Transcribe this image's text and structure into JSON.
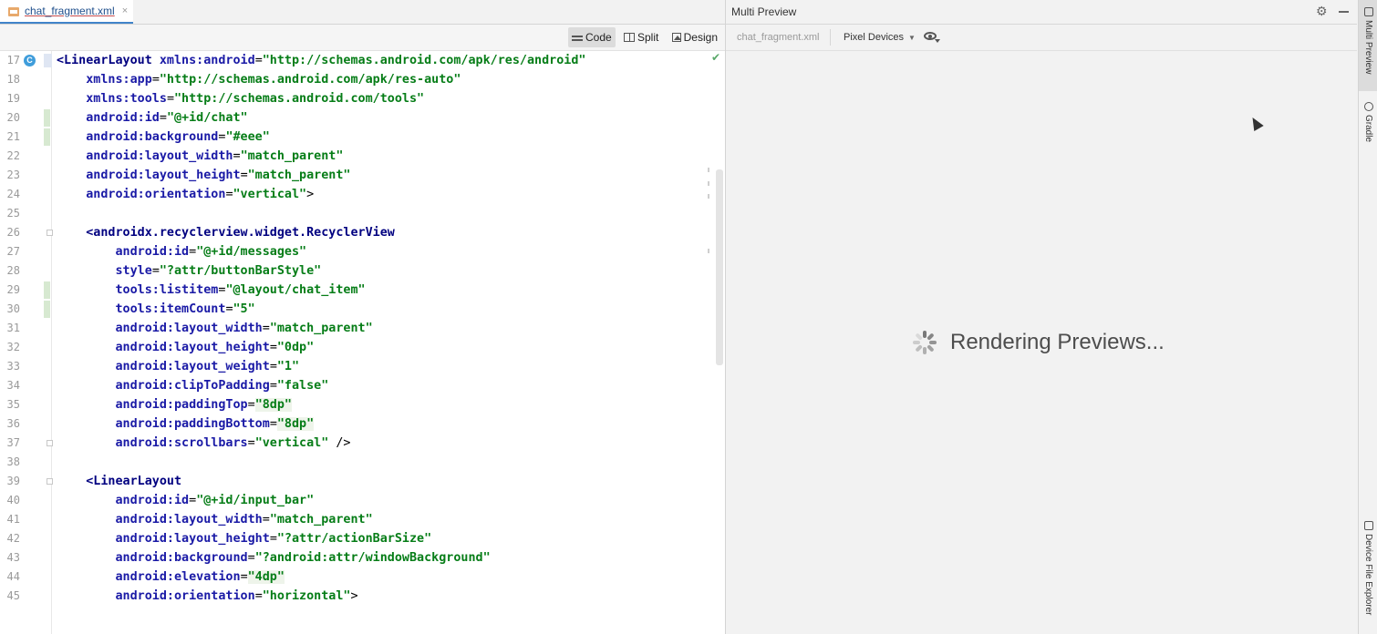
{
  "editor": {
    "tab": {
      "filename": "chat_fragment.xml",
      "close": "×"
    },
    "toolbar": {
      "code": "Code",
      "split": "Split",
      "design": "Design"
    },
    "gutter_badge": "C",
    "lines": [
      {
        "n": "17",
        "indent": "",
        "tokens": [
          [
            "tag",
            "<LinearLayout"
          ],
          [
            "punc",
            " "
          ],
          [
            "attr",
            "xmlns:android"
          ],
          [
            "punc",
            "="
          ],
          [
            "val",
            "\"http://schemas.android.com/apk/res/android\""
          ]
        ]
      },
      {
        "n": "18",
        "indent": "    ",
        "tokens": [
          [
            "attr",
            "xmlns:app"
          ],
          [
            "punc",
            "="
          ],
          [
            "val",
            "\"http://schemas.android.com/apk/res-auto\""
          ]
        ]
      },
      {
        "n": "19",
        "indent": "    ",
        "tokens": [
          [
            "attr",
            "xmlns:tools"
          ],
          [
            "punc",
            "="
          ],
          [
            "val",
            "\"http://schemas.android.com/tools\""
          ]
        ]
      },
      {
        "n": "20",
        "indent": "    ",
        "tokens": [
          [
            "attr",
            "android:id"
          ],
          [
            "punc",
            "="
          ],
          [
            "val",
            "\"@+id/chat\""
          ]
        ]
      },
      {
        "n": "21",
        "indent": "    ",
        "tokens": [
          [
            "attr",
            "android:background"
          ],
          [
            "punc",
            "="
          ],
          [
            "val",
            "\"#eee\""
          ]
        ]
      },
      {
        "n": "22",
        "indent": "    ",
        "tokens": [
          [
            "attr",
            "android:layout_width"
          ],
          [
            "punc",
            "="
          ],
          [
            "val",
            "\"match_parent\""
          ]
        ]
      },
      {
        "n": "23",
        "indent": "    ",
        "tokens": [
          [
            "attr",
            "android:layout_height"
          ],
          [
            "punc",
            "="
          ],
          [
            "val",
            "\"match_parent\""
          ]
        ]
      },
      {
        "n": "24",
        "indent": "    ",
        "tokens": [
          [
            "attr",
            "android:orientation"
          ],
          [
            "punc",
            "="
          ],
          [
            "val",
            "\"vertical\""
          ],
          [
            "punc",
            ">"
          ]
        ]
      },
      {
        "n": "25",
        "indent": "",
        "tokens": []
      },
      {
        "n": "26",
        "indent": "    ",
        "tokens": [
          [
            "tag",
            "<androidx.recyclerview.widget.RecyclerView"
          ]
        ]
      },
      {
        "n": "27",
        "indent": "        ",
        "tokens": [
          [
            "attr",
            "android:id"
          ],
          [
            "punc",
            "="
          ],
          [
            "val",
            "\"@+id/messages\""
          ]
        ]
      },
      {
        "n": "28",
        "indent": "        ",
        "tokens": [
          [
            "attr",
            "style"
          ],
          [
            "punc",
            "="
          ],
          [
            "val",
            "\"?attr/buttonBarStyle\""
          ]
        ]
      },
      {
        "n": "29",
        "indent": "        ",
        "tokens": [
          [
            "attr",
            "tools:listitem"
          ],
          [
            "punc",
            "="
          ],
          [
            "val",
            "\"@layout/chat_item\""
          ]
        ]
      },
      {
        "n": "30",
        "indent": "        ",
        "tokens": [
          [
            "attr",
            "tools:itemCount"
          ],
          [
            "punc",
            "="
          ],
          [
            "val",
            "\"5\""
          ]
        ]
      },
      {
        "n": "31",
        "indent": "        ",
        "tokens": [
          [
            "attr",
            "android:layout_width"
          ],
          [
            "punc",
            "="
          ],
          [
            "val",
            "\"match_parent\""
          ]
        ]
      },
      {
        "n": "32",
        "indent": "        ",
        "tokens": [
          [
            "attr",
            "android:layout_height"
          ],
          [
            "punc",
            "="
          ],
          [
            "val",
            "\"0dp\""
          ]
        ]
      },
      {
        "n": "33",
        "indent": "        ",
        "tokens": [
          [
            "attr",
            "android:layout_weight"
          ],
          [
            "punc",
            "="
          ],
          [
            "val",
            "\"1\""
          ]
        ]
      },
      {
        "n": "34",
        "indent": "        ",
        "tokens": [
          [
            "attr",
            "android:clipToPadding"
          ],
          [
            "punc",
            "="
          ],
          [
            "val",
            "\"false\""
          ]
        ]
      },
      {
        "n": "35",
        "indent": "        ",
        "tokens": [
          [
            "attr",
            "android:paddingTop"
          ],
          [
            "punc",
            "="
          ],
          [
            "num",
            "\"8dp\""
          ]
        ]
      },
      {
        "n": "36",
        "indent": "        ",
        "tokens": [
          [
            "attr",
            "android:paddingBottom"
          ],
          [
            "punc",
            "="
          ],
          [
            "num",
            "\"8dp\""
          ]
        ]
      },
      {
        "n": "37",
        "indent": "        ",
        "tokens": [
          [
            "attr",
            "android:scrollbars"
          ],
          [
            "punc",
            "="
          ],
          [
            "val",
            "\"vertical\""
          ],
          [
            "punc",
            " />"
          ]
        ]
      },
      {
        "n": "38",
        "indent": "",
        "tokens": []
      },
      {
        "n": "39",
        "indent": "    ",
        "tokens": [
          [
            "tag",
            "<LinearLayout"
          ]
        ]
      },
      {
        "n": "40",
        "indent": "        ",
        "tokens": [
          [
            "attr",
            "android:id"
          ],
          [
            "punc",
            "="
          ],
          [
            "val",
            "\"@+id/input_bar\""
          ]
        ]
      },
      {
        "n": "41",
        "indent": "        ",
        "tokens": [
          [
            "attr",
            "android:layout_width"
          ],
          [
            "punc",
            "="
          ],
          [
            "val",
            "\"match_parent\""
          ]
        ]
      },
      {
        "n": "42",
        "indent": "        ",
        "tokens": [
          [
            "attr",
            "android:layout_height"
          ],
          [
            "punc",
            "="
          ],
          [
            "val",
            "\"?attr/actionBarSize\""
          ]
        ]
      },
      {
        "n": "43",
        "indent": "        ",
        "tokens": [
          [
            "attr",
            "android:background"
          ],
          [
            "punc",
            "="
          ],
          [
            "val",
            "\"?android:attr/windowBackground\""
          ]
        ]
      },
      {
        "n": "44",
        "indent": "        ",
        "tokens": [
          [
            "attr",
            "android:elevation"
          ],
          [
            "punc",
            "="
          ],
          [
            "num",
            "\"4dp\""
          ]
        ]
      },
      {
        "n": "45",
        "indent": "        ",
        "tokens": [
          [
            "attr",
            "android:orientation"
          ],
          [
            "punc",
            "="
          ],
          [
            "val",
            "\"horizontal\""
          ],
          [
            "punc",
            ">"
          ]
        ]
      }
    ]
  },
  "preview": {
    "title": "Multi Preview",
    "file": "chat_fragment.xml",
    "devices": "Pixel Devices",
    "status": "Rendering Previews..."
  },
  "toolstrip": {
    "multi_preview": "Multi Preview",
    "gradle": "Gradle",
    "device_file_explorer": "Device File Explorer"
  },
  "colors": {
    "tag": "#000080",
    "attribute": "#1a1aa6",
    "string": "#067d17",
    "accent": "#4083c9"
  }
}
